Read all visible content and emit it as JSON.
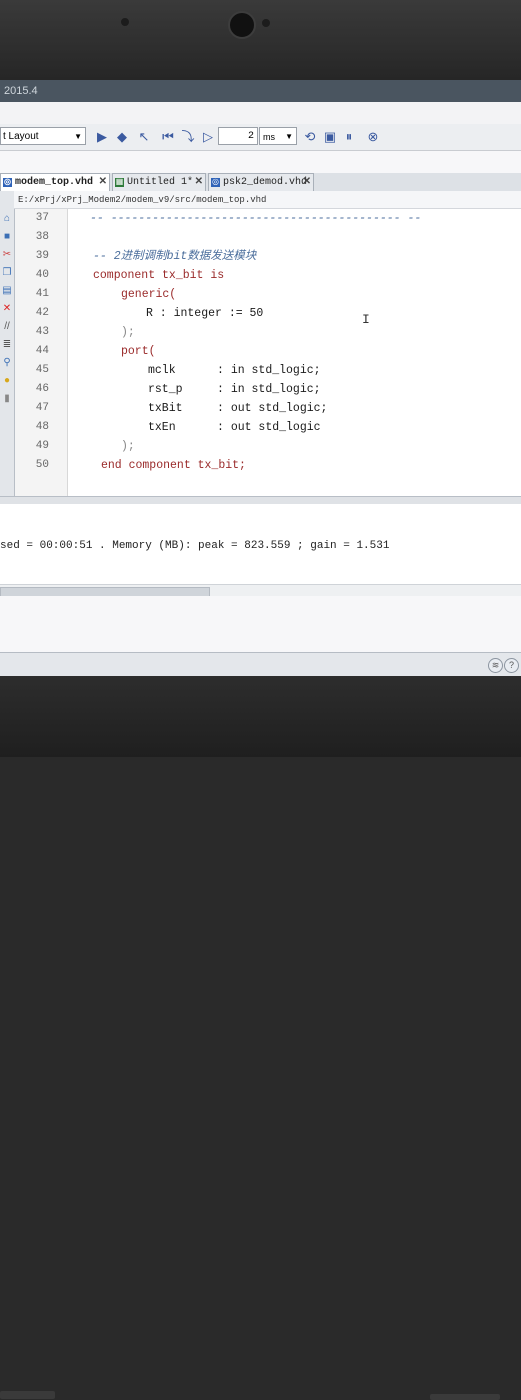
{
  "window": {
    "title": "2015.4"
  },
  "toolbar": {
    "layout_select": "t Layout",
    "run_length_value": "2",
    "run_length_unit": "ms",
    "icons": [
      "run-all-icon",
      "run-for-icon",
      "step-icon",
      "restart-icon",
      "run-icon",
      "relaunch-icon",
      "zoom-icon",
      "break-icon",
      "pause-icon",
      "stop-icon",
      "help-icon"
    ]
  },
  "tabs": [
    {
      "label": "modem_top.vhd",
      "active": true
    },
    {
      "label": "Untitled 1*",
      "active": false
    },
    {
      "label": "psk2_demod.vhd",
      "active": false
    }
  ],
  "editor": {
    "file_path": "E:/xPrj/xPrj_Modem2/modem_v9/src/modem_top.vhd",
    "lines": [
      {
        "num": "37",
        "text": "-- ------------------------------------------ --"
      },
      {
        "num": "38",
        "text": ""
      },
      {
        "num": "39",
        "text": "-- 2进制调制bit数据发送模块"
      },
      {
        "num": "40",
        "text": "component tx_bit is"
      },
      {
        "num": "41",
        "text": "generic("
      },
      {
        "num": "42",
        "text": "R : integer := 50"
      },
      {
        "num": "43",
        "text": ");"
      },
      {
        "num": "44",
        "text": "port("
      },
      {
        "num": "45",
        "text": "mclk      : in std_logic;"
      },
      {
        "num": "46",
        "text": "rst_p     : in std_logic;"
      },
      {
        "num": "47",
        "text": "txBit     : out std_logic;"
      },
      {
        "num": "48",
        "text": "txEn      : out std_logic"
      },
      {
        "num": "49",
        "text": ");"
      },
      {
        "num": "50",
        "text": "end component tx_bit;"
      }
    ]
  },
  "console": {
    "text": "sed = 00:00:51 . Memory (MB): peak = 823.559 ; gain = 1.531"
  },
  "colors": {
    "keyword": "#9a2a2a",
    "comment": "#4b6e9c",
    "tab_active_bg": "#ffffff"
  }
}
